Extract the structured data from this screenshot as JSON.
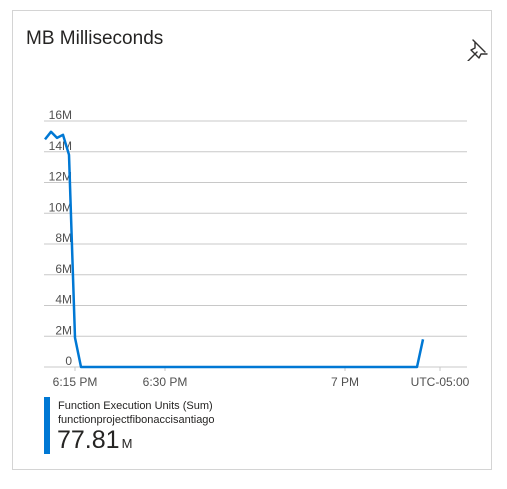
{
  "card": {
    "title": "MB Milliseconds",
    "pin_icon": "pin-icon"
  },
  "colors": {
    "series": "#0078d4",
    "grid": "#c8c8c8",
    "axis_text": "#505050"
  },
  "chart_data": {
    "type": "line",
    "title": "",
    "xlabel": "",
    "ylabel": "",
    "yticks": [
      "16M",
      "14M",
      "12M",
      "10M",
      "8M",
      "6M",
      "4M",
      "2M",
      "0"
    ],
    "ylim": [
      0,
      16000000
    ],
    "xticks": [
      "6:15 PM",
      "6:30 PM",
      "7 PM",
      "UTC-05:00"
    ],
    "grid": true,
    "series": [
      {
        "name": "Function Execution Units (Sum)",
        "x": [
          "6:10 PM",
          "6:11 PM",
          "6:12 PM",
          "6:13 PM",
          "6:14 PM",
          "6:15 PM",
          "6:16 PM",
          "6:17 PM",
          "6:18 PM",
          "7:12 PM",
          "7:13 PM"
        ],
        "values": [
          14800000,
          15300000,
          14900000,
          15100000,
          13800000,
          1900000,
          0,
          0,
          0,
          0,
          1800000
        ]
      }
    ]
  },
  "legend": {
    "name": "Function Execution Units (Sum)",
    "resource": "functionprojectfibonaccisantiago",
    "value": "77.81",
    "unit": "M"
  }
}
